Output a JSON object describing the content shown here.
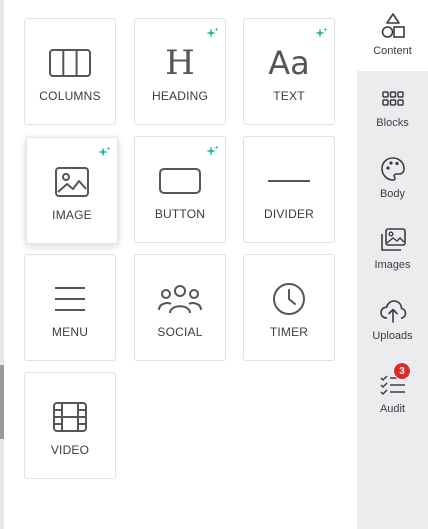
{
  "blocks": [
    {
      "label": "COLUMNS",
      "icon": "columns-icon",
      "ai": false
    },
    {
      "label": "HEADING",
      "icon": "heading-icon",
      "ai": true
    },
    {
      "label": "TEXT",
      "icon": "text-icon",
      "ai": true
    },
    {
      "label": "IMAGE",
      "icon": "image-icon",
      "ai": true
    },
    {
      "label": "BUTTON",
      "icon": "button-icon",
      "ai": true
    },
    {
      "label": "DIVIDER",
      "icon": "divider-icon",
      "ai": false
    },
    {
      "label": "MENU",
      "icon": "menu-icon",
      "ai": false
    },
    {
      "label": "SOCIAL",
      "icon": "social-icon",
      "ai": false
    },
    {
      "label": "TIMER",
      "icon": "timer-icon",
      "ai": false
    },
    {
      "label": "VIDEO",
      "icon": "video-icon",
      "ai": false
    }
  ],
  "glyphs": {
    "heading": "H",
    "text": "Aa"
  },
  "sidebar": {
    "items": [
      {
        "label": "Content",
        "icon": "shapes-icon",
        "active": true
      },
      {
        "label": "Blocks",
        "icon": "grid-dots-icon"
      },
      {
        "label": "Body",
        "icon": "palette-icon"
      },
      {
        "label": "Images",
        "icon": "images-icon"
      },
      {
        "label": "Uploads",
        "icon": "cloud-upload-icon"
      },
      {
        "label": "Audit",
        "icon": "checklist-icon",
        "badge": "3"
      }
    ]
  },
  "colors": {
    "accent_sparkle": "#19b5a0",
    "badge": "#e02a2a"
  }
}
